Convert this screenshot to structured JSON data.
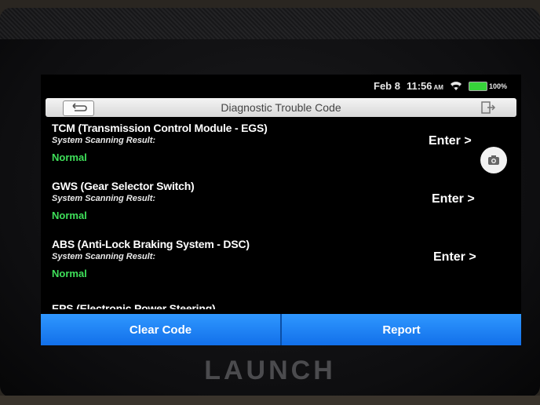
{
  "status": {
    "date": "Feb 8",
    "time": "11:56",
    "ampm": "AM",
    "battery": "100%"
  },
  "header": {
    "title": "Diagnostic Trouble Code"
  },
  "items": [
    {
      "name": "TCM (Transmission Control Module - EGS)",
      "subtitle": "System Scanning Result:",
      "status": "Normal",
      "action": "Enter >"
    },
    {
      "name": "GWS (Gear Selector Switch)",
      "subtitle": "System Scanning Result:",
      "status": "Normal",
      "action": "Enter >"
    },
    {
      "name": "ABS (Anti-Lock Braking System - DSC)",
      "subtitle": "System Scanning Result:",
      "status": "Normal",
      "action": "Enter >"
    },
    {
      "name": "EPS (Electronic Power Steering)",
      "subtitle": "",
      "status": "",
      "action": ""
    }
  ],
  "buttons": {
    "clear_code": "Clear Code",
    "report": "Report"
  },
  "brand": "LAUNCH",
  "colors": {
    "status_normal": "#3fe05a",
    "button_blue": "#1f86f5",
    "battery_green": "#37d33a"
  }
}
